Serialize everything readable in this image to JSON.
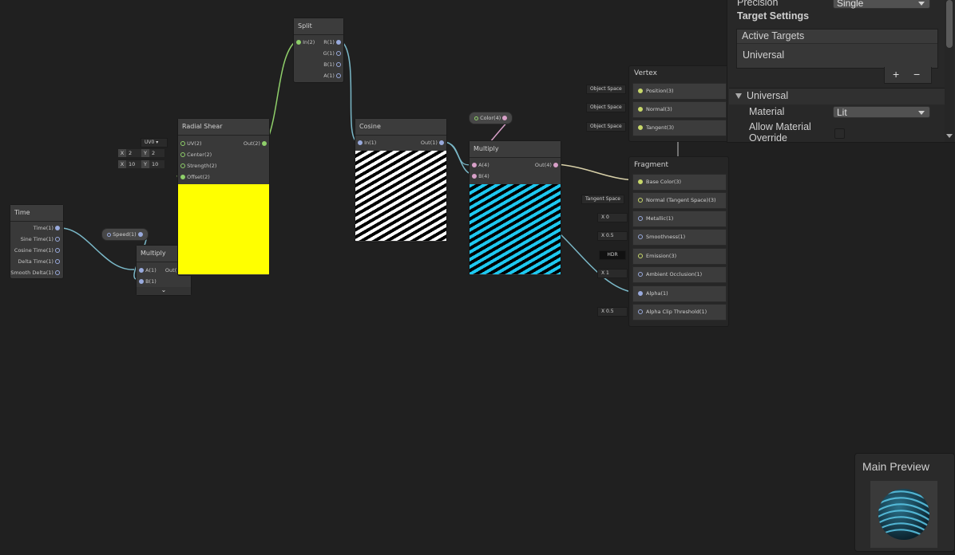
{
  "nodes": {
    "time": {
      "title": "Time",
      "outputs": [
        "Time(1)",
        "Sine Time(1)",
        "Cosine Time(1)",
        "Delta Time(1)",
        "Smooth Delta(1)"
      ]
    },
    "speed": {
      "label": "Speed(1)"
    },
    "multiply1": {
      "title": "Multiply",
      "in_a": "A(1)",
      "in_b": "B(1)",
      "out": "Out(1)",
      "expand": "⌄"
    },
    "radial_shear": {
      "title": "Radial Shear",
      "uv": "UV(2)",
      "center": "Center(2)",
      "strength": "Strength(2)",
      "offset": "Offset(2)",
      "out": "Out(2)",
      "uv_value": "UV0",
      "center_x": "2",
      "center_y": "2",
      "strength_x": "10",
      "strength_y": "10",
      "x_label": "X",
      "y_label": "Y"
    },
    "split": {
      "title": "Split",
      "in": "In(2)",
      "outputs": [
        "R(1)",
        "G(1)",
        "B(1)",
        "A(1)"
      ]
    },
    "cosine": {
      "title": "Cosine",
      "in": "In(1)",
      "out": "Out(1)"
    },
    "color": {
      "label": "Color(4)"
    },
    "multiply2": {
      "title": "Multiply",
      "in_a": "A(4)",
      "in_b": "B(4)",
      "out": "Out(4)"
    }
  },
  "vertex": {
    "title": "Vertex",
    "rows": [
      {
        "input": "Object Space",
        "label": "Position(3)"
      },
      {
        "input": "Object Space",
        "label": "Normal(3)"
      },
      {
        "input": "Object Space",
        "label": "Tangent(3)"
      }
    ]
  },
  "fragment": {
    "title": "Fragment",
    "rows": [
      {
        "input": "",
        "label": "Base Color(3)"
      },
      {
        "input": "Tangent Space",
        "label": "Normal (Tangent Space)(3)"
      },
      {
        "input": "X  0",
        "label": "Metallic(1)"
      },
      {
        "input": "X  0.5",
        "label": "Smoothness(1)"
      },
      {
        "input": "HDR",
        "label": "Emission(3)"
      },
      {
        "input": "X  1",
        "label": "Ambient Occlusion(1)"
      },
      {
        "input": "",
        "label": "Alpha(1)"
      },
      {
        "input": "X  0.5",
        "label": "Alpha Clip Threshold(1)"
      }
    ]
  },
  "inspector": {
    "precision_label": "Precision",
    "precision_value": "Single",
    "target_settings": "Target Settings",
    "active_targets": "Active Targets",
    "target_item": "Universal",
    "add": "+",
    "remove": "−",
    "section": "Universal",
    "material_label": "Material",
    "material_value": "Lit",
    "allow_override": "Allow Material Override"
  },
  "preview": {
    "title": "Main Preview"
  },
  "colors": {
    "yellow": "#ffff00",
    "cyan": "#1ec8f0",
    "wire_blue": "#7ab8c8",
    "wire_green": "#8fcf6a"
  }
}
